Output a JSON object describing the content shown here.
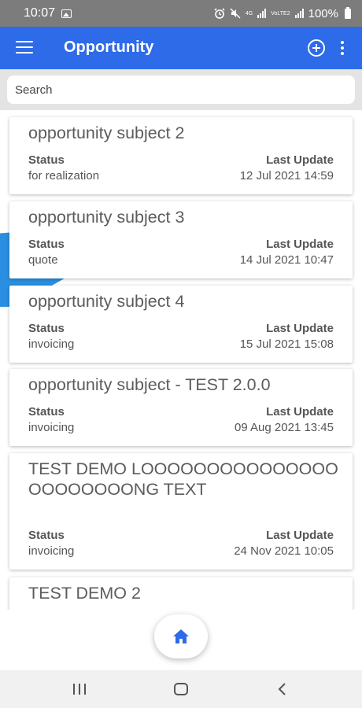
{
  "status_bar": {
    "time": "10:07",
    "network_4g": "4G",
    "network_volte": "VoLTE2",
    "battery": "100%"
  },
  "app_bar": {
    "title": "Opportunity"
  },
  "search": {
    "placeholder": "Search",
    "value": ""
  },
  "labels": {
    "status": "Status",
    "last_update": "Last Update"
  },
  "opportunities": [
    {
      "subject": "opportunity subject 2",
      "status": "for realization",
      "last_update": "12 Jul 2021 14:59"
    },
    {
      "subject": "opportunity subject 3",
      "status": "quote",
      "last_update": "14 Jul 2021 10:47"
    },
    {
      "subject": "opportunity subject 4",
      "status": "invoicing",
      "last_update": "15 Jul 2021 15:08"
    },
    {
      "subject": "opportunity subject - TEST 2.0.0",
      "status": "invoicing",
      "last_update": "09 Aug 2021 13:45"
    },
    {
      "subject": "TEST DEMO LOOOOOOOOOOOOOOOOOOOOOOONG TEXT",
      "status": "invoicing",
      "last_update": "24 Nov 2021 10:05"
    },
    {
      "subject": "TEST DEMO 2",
      "status": "",
      "last_update": ""
    }
  ],
  "icons": {
    "menu": "menu-icon",
    "add": "add-circle-icon",
    "more": "more-vertical-icon",
    "home": "home-icon",
    "nav_recents": "recents-icon",
    "nav_home": "nav-home-icon",
    "nav_back": "back-icon"
  },
  "colors": {
    "app_bar": "#2d6be8",
    "status_bar": "#7c7c7c",
    "accent_wedge": "#2a8fe0",
    "home_icon": "#2d6be8"
  }
}
